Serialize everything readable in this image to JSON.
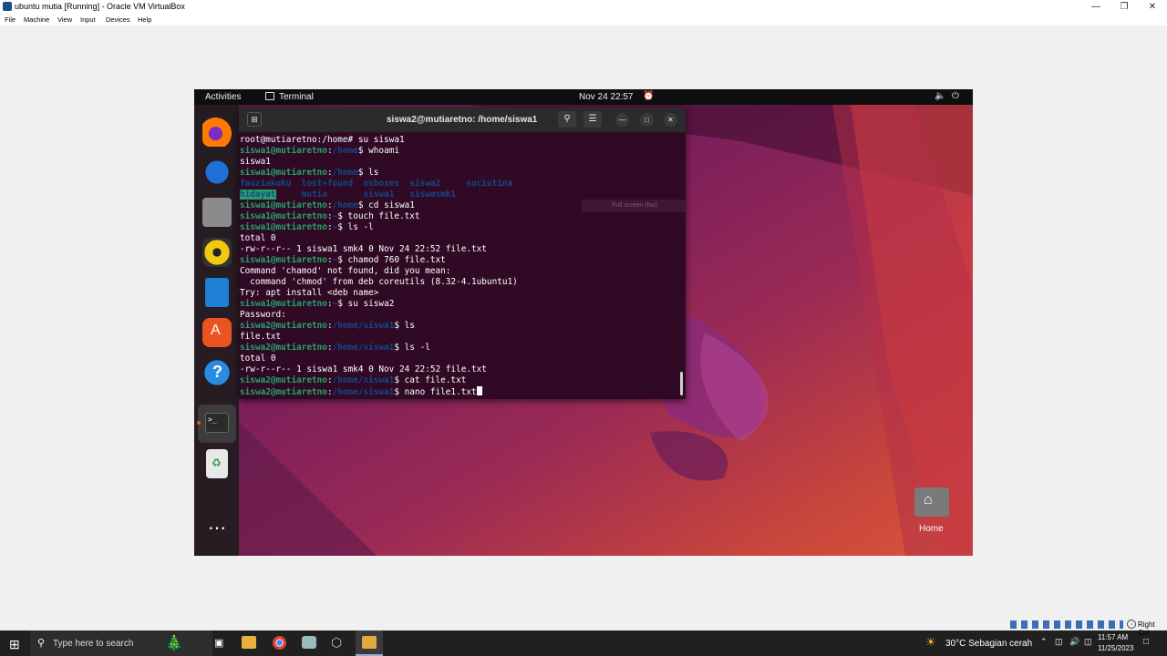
{
  "vbox": {
    "title": "ubuntu mutia [Running] - Oracle VM VirtualBox",
    "menu": [
      "File",
      "Machine",
      "View",
      "Input",
      "Devices",
      "Help"
    ],
    "host_key": "Right Ctrl"
  },
  "gnome": {
    "activities": "Activities",
    "app_name": "Terminal",
    "clock": "Nov 24  22:57",
    "home_label": "Home"
  },
  "terminal": {
    "title": "siswa2@mutiaretno: /home/siswa1",
    "tooltip": "Full screen (hw)",
    "lines": [
      [
        {
          "t": "root@mutiaretno:/home# su siswa1",
          "c": ""
        }
      ],
      [
        {
          "t": "siswa1@mutiaretno",
          "c": "u"
        },
        {
          "t": ":",
          "c": ""
        },
        {
          "t": "/home",
          "c": "p"
        },
        {
          "t": "$ whoami",
          "c": ""
        }
      ],
      [
        {
          "t": "siswa1",
          "c": ""
        }
      ],
      [
        {
          "t": "siswa1@mutiaretno",
          "c": "u"
        },
        {
          "t": ":",
          "c": ""
        },
        {
          "t": "/home",
          "c": "p"
        },
        {
          "t": "$ ls",
          "c": ""
        }
      ],
      [
        {
          "t": "fauziakuku  lost+found  osboxes  siswa2     suciutina",
          "c": "d"
        }
      ],
      [
        {
          "t": "hidayat",
          "c": "hl"
        },
        {
          "t": "     mutia       siswa1   siswasmk1",
          "c": "d"
        }
      ],
      [
        {
          "t": "siswa1@mutiaretno",
          "c": "u"
        },
        {
          "t": ":",
          "c": ""
        },
        {
          "t": "/home",
          "c": "p"
        },
        {
          "t": "$ cd siswa1",
          "c": ""
        }
      ],
      [
        {
          "t": "siswa1@mutiaretno",
          "c": "u"
        },
        {
          "t": ":",
          "c": ""
        },
        {
          "t": "~",
          "c": "p"
        },
        {
          "t": "$ touch file.txt",
          "c": ""
        }
      ],
      [
        {
          "t": "siswa1@mutiaretno",
          "c": "u"
        },
        {
          "t": ":",
          "c": ""
        },
        {
          "t": "~",
          "c": "p"
        },
        {
          "t": "$ ls -l",
          "c": ""
        }
      ],
      [
        {
          "t": "total 0",
          "c": ""
        }
      ],
      [
        {
          "t": "-rw-r--r-- 1 siswa1 smk4 0 Nov 24 22:52 file.txt",
          "c": ""
        }
      ],
      [
        {
          "t": "siswa1@mutiaretno",
          "c": "u"
        },
        {
          "t": ":",
          "c": ""
        },
        {
          "t": "~",
          "c": "p"
        },
        {
          "t": "$ chamod 760 file.txt",
          "c": ""
        }
      ],
      [
        {
          "t": "Command 'chamod' not found, did you mean:",
          "c": ""
        }
      ],
      [
        {
          "t": "  command 'chmod' from deb coreutils (8.32-4.1ubuntu1)",
          "c": ""
        }
      ],
      [
        {
          "t": "Try: apt install <deb name>",
          "c": ""
        }
      ],
      [
        {
          "t": "siswa1@mutiaretno",
          "c": "u"
        },
        {
          "t": ":",
          "c": ""
        },
        {
          "t": "~",
          "c": "p"
        },
        {
          "t": "$ su siswa2",
          "c": ""
        }
      ],
      [
        {
          "t": "Password:",
          "c": ""
        }
      ],
      [
        {
          "t": "siswa2@mutiaretno",
          "c": "u"
        },
        {
          "t": ":",
          "c": ""
        },
        {
          "t": "/home/siswa1",
          "c": "p"
        },
        {
          "t": "$ ls",
          "c": ""
        }
      ],
      [
        {
          "t": "file.txt",
          "c": ""
        }
      ],
      [
        {
          "t": "siswa2@mutiaretno",
          "c": "u"
        },
        {
          "t": ":",
          "c": ""
        },
        {
          "t": "/home/siswa1",
          "c": "p"
        },
        {
          "t": "$ ls -l",
          "c": ""
        }
      ],
      [
        {
          "t": "total 0",
          "c": ""
        }
      ],
      [
        {
          "t": "-rw-r--r-- 1 siswa1 smk4 0 Nov 24 22:52 file.txt",
          "c": ""
        }
      ],
      [
        {
          "t": "siswa2@mutiaretno",
          "c": "u"
        },
        {
          "t": ":",
          "c": ""
        },
        {
          "t": "/home/siswa1",
          "c": "p"
        },
        {
          "t": "$ cat file.txt",
          "c": ""
        }
      ],
      [
        {
          "t": "siswa2@mutiaretno",
          "c": "u"
        },
        {
          "t": ":",
          "c": ""
        },
        {
          "t": "/home/siswa1",
          "c": "p"
        },
        {
          "t": "$ nano file1.txt",
          "c": ""
        }
      ]
    ]
  },
  "dock": [
    "firefox-icon",
    "thunderbird-icon",
    "files-icon",
    "rhythmbox-icon",
    "writer-icon",
    "software-icon",
    "help-icon",
    "terminal-icon",
    "trash-icon",
    "apps-grid-icon"
  ],
  "taskbar": {
    "search_placeholder": "Type here to search",
    "weather": "30°C  Sebagian cerah",
    "time": "11:57 AM",
    "date": "11/25/2023"
  }
}
